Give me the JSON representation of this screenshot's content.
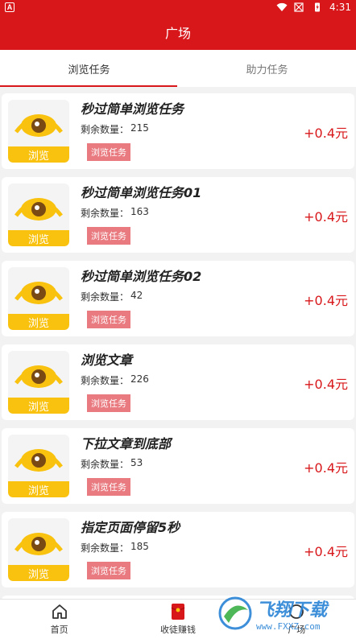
{
  "status_bar": {
    "app_badge": "A",
    "time": "4:31"
  },
  "header": {
    "title": "广场"
  },
  "tabs": [
    {
      "label": "浏览任务",
      "active": true
    },
    {
      "label": "助力任务",
      "active": false
    }
  ],
  "tasks": [
    {
      "title": "秒过简单浏览任务",
      "remain_label": "剩余数量：",
      "remain": "215",
      "button": "浏览任务",
      "reward": "+0.4元",
      "thumb_label": "浏览"
    },
    {
      "title": "秒过简单浏览任务01",
      "remain_label": "剩余数量：",
      "remain": "163",
      "button": "浏览任务",
      "reward": "+0.4元",
      "thumb_label": "浏览"
    },
    {
      "title": "秒过简单浏览任务02",
      "remain_label": "剩余数量：",
      "remain": "42",
      "button": "浏览任务",
      "reward": "+0.4元",
      "thumb_label": "浏览"
    },
    {
      "title": "浏览文章",
      "remain_label": "剩余数量：",
      "remain": "226",
      "button": "浏览任务",
      "reward": "+0.4元",
      "thumb_label": "浏览"
    },
    {
      "title": "下拉文章到底部",
      "remain_label": "剩余数量：",
      "remain": "53",
      "button": "浏览任务",
      "reward": "+0.4元",
      "thumb_label": "浏览"
    },
    {
      "title": "指定页面停留5秒",
      "remain_label": "剩余数量：",
      "remain": "185",
      "button": "浏览任务",
      "reward": "+0.4元",
      "thumb_label": "浏览"
    }
  ],
  "bottom_nav": [
    {
      "label": "首页",
      "icon": "home-icon"
    },
    {
      "label": "收徒赚钱",
      "icon": "red-envelope-icon"
    },
    {
      "label": "广场",
      "icon": "plaza-icon"
    }
  ],
  "watermark": {
    "big": "飞翔下载",
    "small": "www.FXXZ.com"
  },
  "colors": {
    "brand": "#d8171a",
    "thumb_yellow": "#f9c20f",
    "button_pink": "#e87a80"
  }
}
